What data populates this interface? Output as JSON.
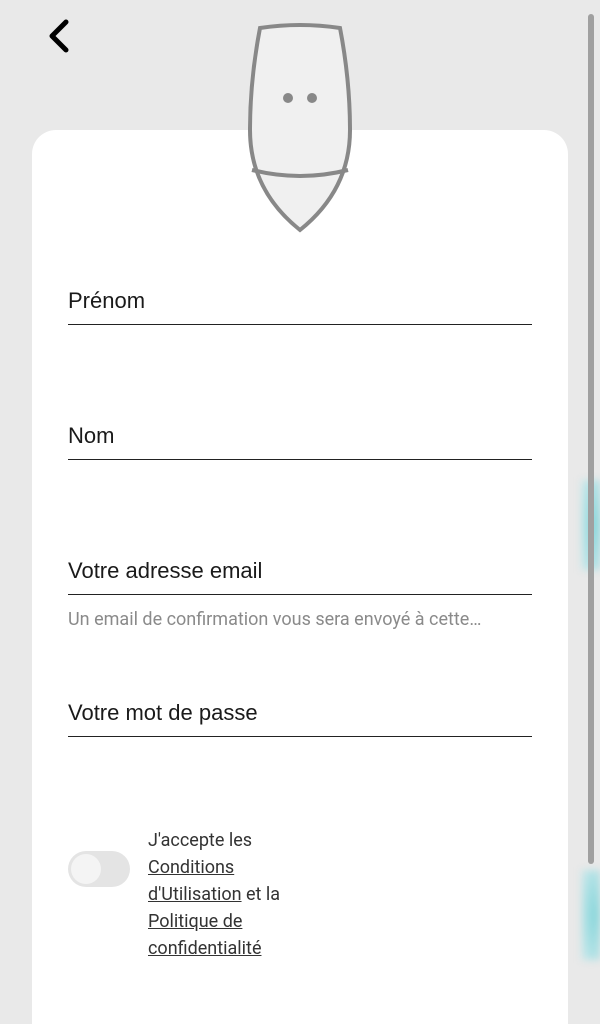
{
  "form": {
    "firstName": {
      "placeholder": "Prénom"
    },
    "lastName": {
      "placeholder": "Nom"
    },
    "email": {
      "placeholder": "Votre adresse email",
      "helper": "Un email de confirmation vous sera envoyé à cette…"
    },
    "password": {
      "placeholder": "Votre mot de passe"
    },
    "consent": {
      "prefix": "J'accepte les ",
      "terms": "Conditions d'Utilisation",
      "mid": " et la ",
      "privacy": "Politique de confidentialité"
    }
  }
}
